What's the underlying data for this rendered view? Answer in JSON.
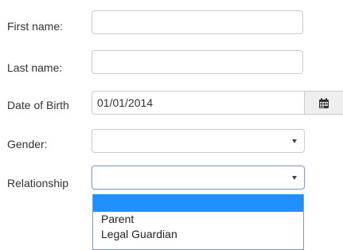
{
  "form": {
    "first_name": {
      "label": "First name:",
      "value": ""
    },
    "last_name": {
      "label": "Last name:",
      "value": ""
    },
    "date_of_birth": {
      "label": "Date of Birth",
      "value": "01/01/2014",
      "icon": "calendar-icon"
    },
    "gender": {
      "label": "Gender:",
      "selected": "",
      "icon": "caret-down-icon"
    },
    "relationship": {
      "label": "Relationship",
      "selected": "",
      "icon": "caret-down-icon",
      "options": [
        "",
        "Parent",
        "Legal Guardian"
      ],
      "highlighted_index": 0
    }
  },
  "colors": {
    "highlight": "#1e90ff",
    "focus_border": "#8ea2d0",
    "border": "#cccccc",
    "addon_bg": "#eeeeee"
  }
}
